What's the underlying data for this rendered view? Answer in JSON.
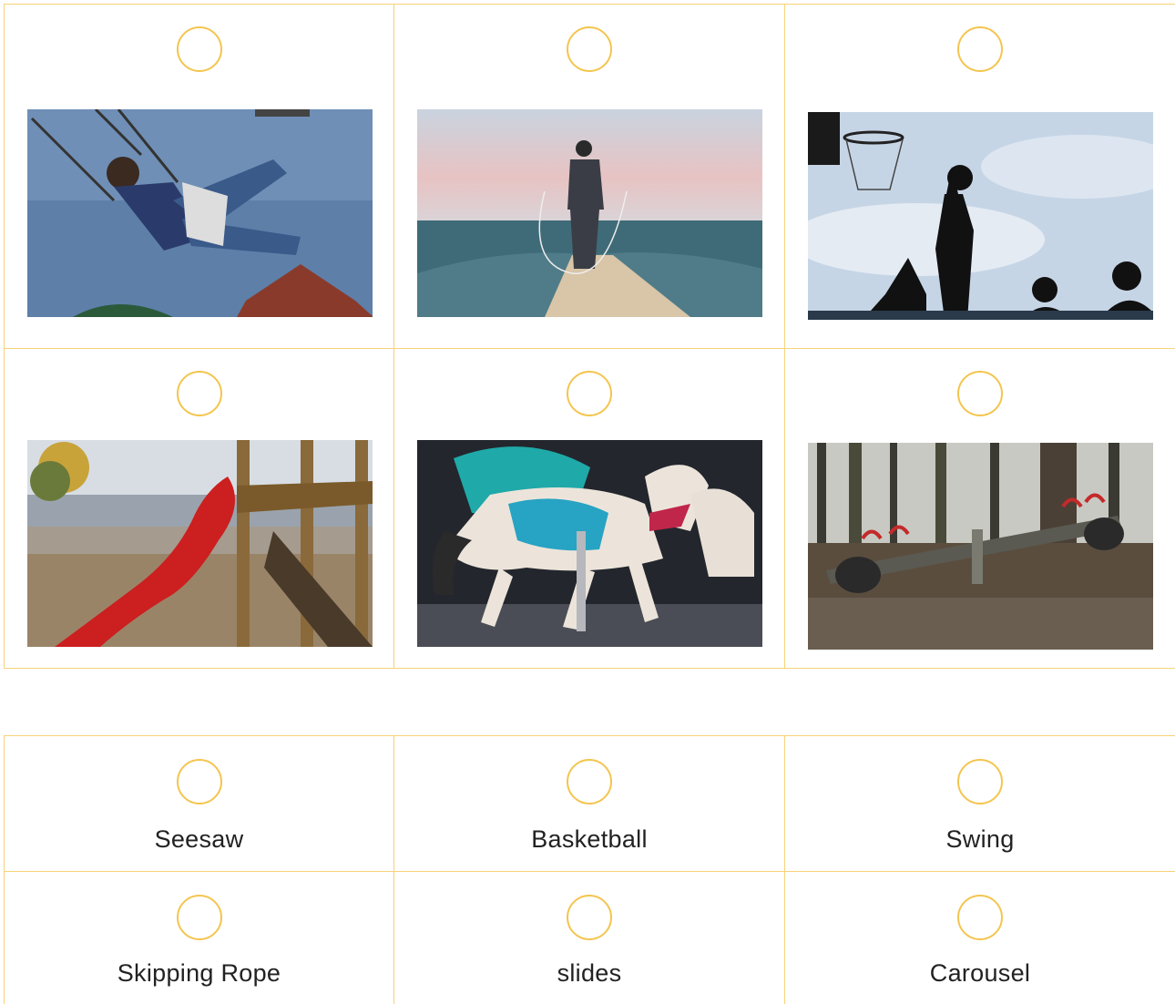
{
  "images": [
    {
      "icon": "swing-photo-icon"
    },
    {
      "icon": "skipping-rope-photo-icon"
    },
    {
      "icon": "basketball-photo-icon"
    },
    {
      "icon": "slide-photo-icon"
    },
    {
      "icon": "carousel-photo-icon"
    },
    {
      "icon": "seesaw-photo-icon"
    }
  ],
  "labels": [
    {
      "text": "Seesaw"
    },
    {
      "text": "Basketball"
    },
    {
      "text": "Swing"
    },
    {
      "text": "Skipping Rope"
    },
    {
      "text": "slides"
    },
    {
      "text": "Carousel"
    }
  ],
  "colors": {
    "border": "#f6d27a",
    "radio": "#f4c54f",
    "text": "#222222"
  }
}
